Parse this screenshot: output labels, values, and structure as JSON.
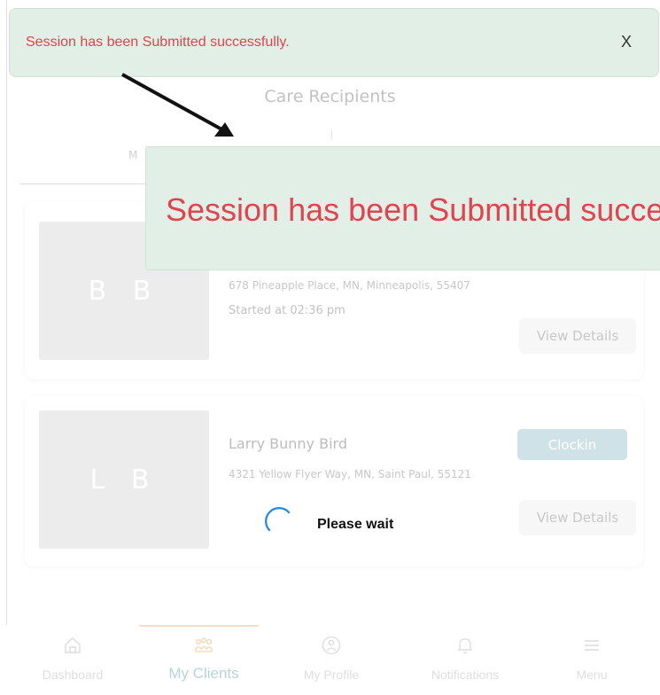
{
  "page": {
    "header_title": "Care Recipients",
    "tab_partial": "M"
  },
  "toast": {
    "message": "Session has been Submitted successfully.",
    "close_label": "X",
    "zoom_message": "Session has been Submitted successfully."
  },
  "clients": [
    {
      "initials": "B B",
      "address": "678 Pineapple Place, MN, Minneapolis, 55407",
      "started": "Started at 02:36 pm",
      "view_details_label": "View Details"
    },
    {
      "initials": "L B",
      "name": "Larry Bunny Bird",
      "address": "4321 Yellow Flyer Way, MN, Saint Paul, 55121",
      "clockin_label": "Clockin",
      "view_details_label": "View Details"
    }
  ],
  "loading": {
    "label": "Please wait"
  },
  "bottom_nav": {
    "items": [
      {
        "label": "Dashboard",
        "icon": "home-icon"
      },
      {
        "label": "My Clients",
        "icon": "people-icon",
        "active": true
      },
      {
        "label": "My Profile",
        "icon": "profile-icon"
      },
      {
        "label": "Notifications",
        "icon": "bell-icon"
      },
      {
        "label": "Menu",
        "icon": "hamburger-icon"
      }
    ]
  },
  "colors": {
    "toast_bg": "#e1efe6",
    "toast_text": "#e0444e",
    "active_nav": "#b5d4dc",
    "clockin_bg": "#cfe2e8"
  }
}
